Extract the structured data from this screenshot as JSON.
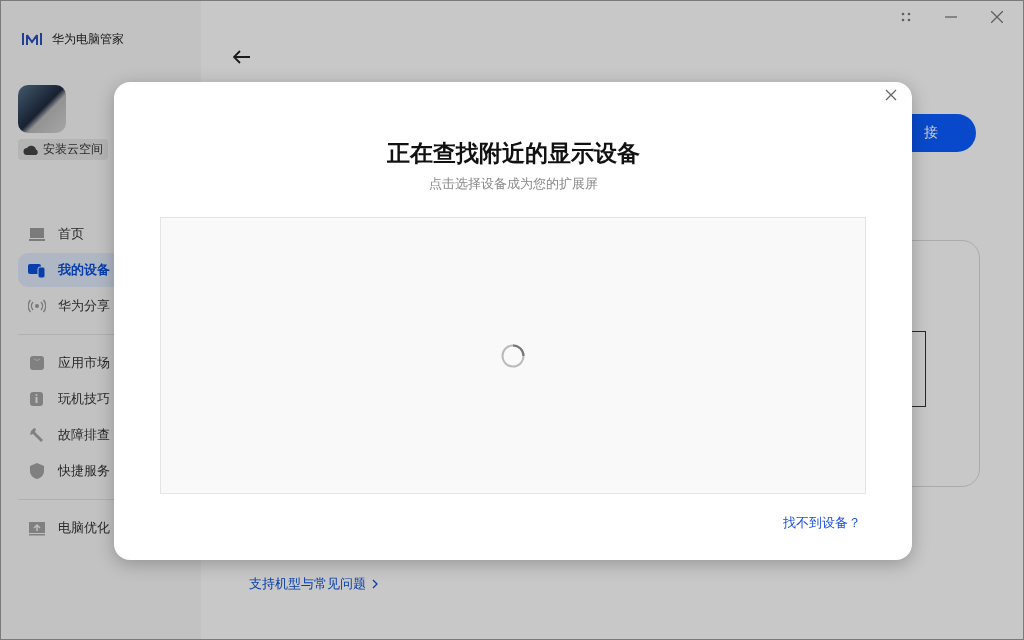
{
  "app": {
    "title": "华为电脑管家"
  },
  "account": {
    "badge": "安装云空间"
  },
  "nav_sections": [
    [
      {
        "label": "首页",
        "selected": false
      },
      {
        "label": "我的设备",
        "selected": true
      },
      {
        "label": "华为分享",
        "selected": false
      }
    ],
    [
      {
        "label": "应用市场",
        "selected": false
      },
      {
        "label": "玩机技巧",
        "selected": false
      },
      {
        "label": "故障排查",
        "selected": false
      },
      {
        "label": "快捷服务",
        "selected": false
      }
    ],
    [
      {
        "label": "电脑优化",
        "selected": false
      }
    ]
  ],
  "main": {
    "connect_button": {
      "label": "接"
    },
    "help_link": "支持机型与常见问题"
  },
  "dialog": {
    "title": "正在查找附近的显示设备",
    "subtitle": "点击选择设备成为您的扩展屏",
    "searching": true,
    "help_link": "找不到设备？"
  }
}
